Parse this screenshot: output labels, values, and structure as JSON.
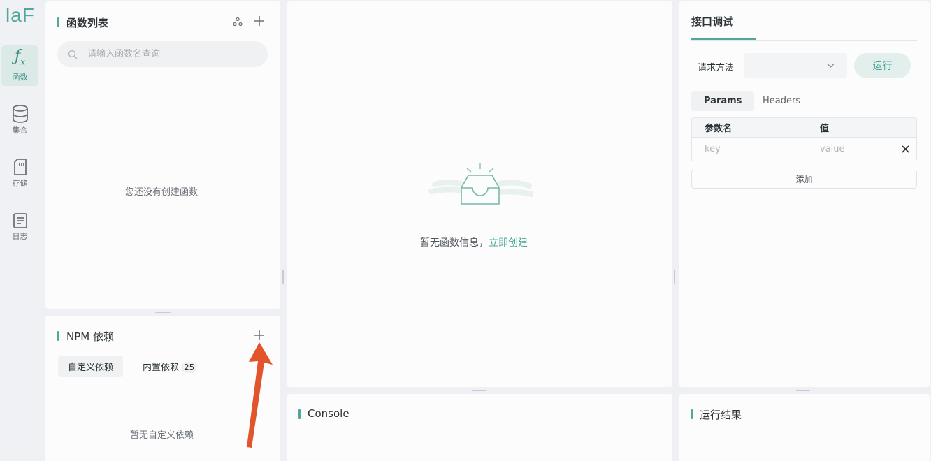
{
  "sidebar": {
    "logo": "laF",
    "items": [
      {
        "icon": "function-icon",
        "label": "函数"
      },
      {
        "icon": "database-icon",
        "label": "集合"
      },
      {
        "icon": "storage-icon",
        "label": "存储"
      },
      {
        "icon": "log-icon",
        "label": "日志"
      }
    ]
  },
  "functions_panel": {
    "title": "函数列表",
    "search_placeholder": "请输入函数名查询",
    "empty_text": "您还没有创建函数"
  },
  "npm_panel": {
    "title": "NPM 依赖",
    "tabs": [
      {
        "label": "自定义依赖"
      },
      {
        "label": "内置依赖",
        "count": "25"
      }
    ],
    "empty_text": "暂无自定义依赖"
  },
  "editor": {
    "empty_text": "暂无函数信息，",
    "create_link": "立即创建"
  },
  "console": {
    "title": "Console"
  },
  "debug_panel": {
    "title": "接口调试",
    "method_label": "请求方法",
    "run_button": "运行",
    "tabs": [
      "Params",
      "Headers"
    ],
    "table_headers": [
      "参数名",
      "值"
    ],
    "key_placeholder": "key",
    "value_placeholder": "value",
    "add_button": "添加"
  },
  "result_panel": {
    "title": "运行结果"
  },
  "colors": {
    "accent": "#4fa89a",
    "annotation_arrow": "#e2542c"
  }
}
